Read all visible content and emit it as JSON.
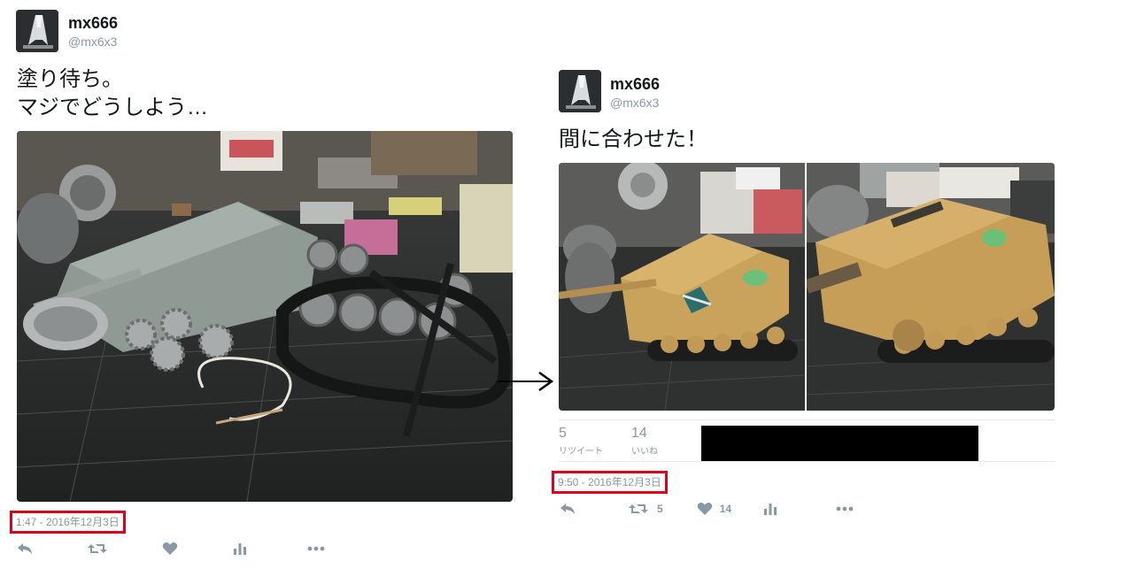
{
  "left_tweet": {
    "author": {
      "name": "mx666",
      "handle": "@mx6x3"
    },
    "text": "塗り待ち。\nマジでどうしよう…",
    "image_alt": "unpainted tank model parts on a cutting mat",
    "timestamp": "1:47 - 2016年12月3日",
    "actions": [
      "reply-icon",
      "retweet-icon",
      "like-icon",
      "analytics-icon",
      "more-icon"
    ]
  },
  "right_tweet": {
    "author": {
      "name": "mx666",
      "handle": "@mx6x3"
    },
    "text": "間に合わせた！",
    "image_alts": [
      "painted tank model, front view",
      "painted tank model, rear view"
    ],
    "stats": {
      "retweets": {
        "count": "5",
        "label": "リツイート"
      },
      "likes": {
        "count": "14",
        "label": "いいね"
      }
    },
    "timestamp": "9:50 - 2016年12月3日",
    "actions": {
      "retweet_count": "5",
      "like_count": "14"
    }
  },
  "colors": {
    "highlight_box": "#e0001a",
    "muted_text": "#8899a6",
    "divider": "#e1e8ed"
  }
}
